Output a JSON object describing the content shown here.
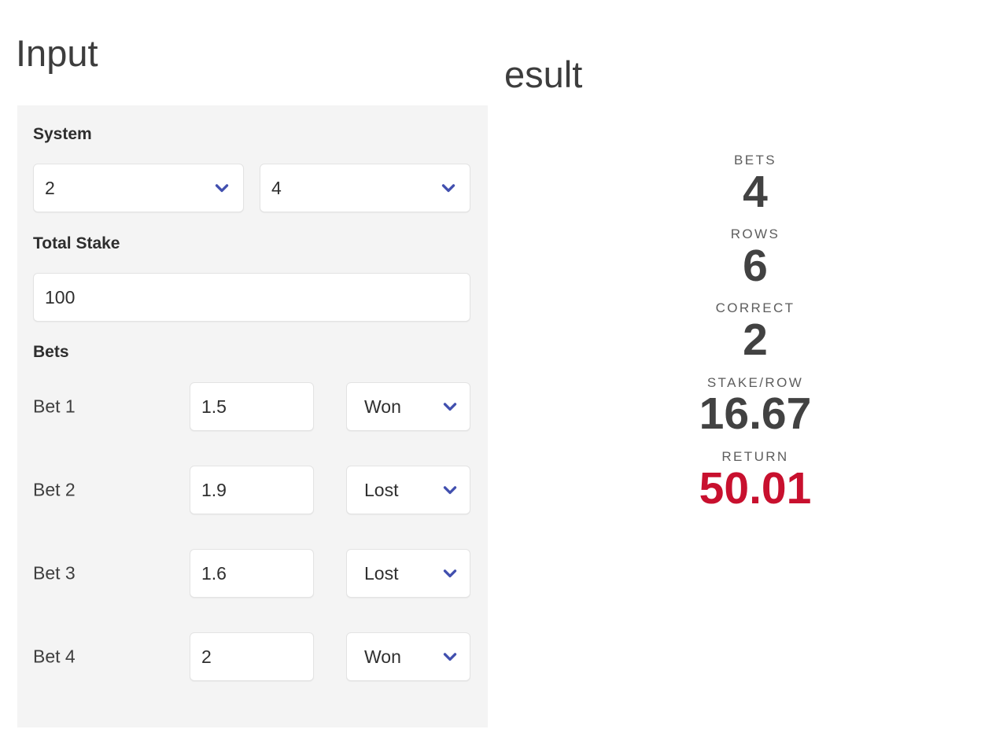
{
  "headings": {
    "input": "Input",
    "result": "esult"
  },
  "input_panel": {
    "system": {
      "label": "System",
      "select_left": {
        "value": "2",
        "icon": "chevron-down-icon"
      },
      "select_right": {
        "value": "4",
        "icon": "chevron-down-icon"
      }
    },
    "total_stake": {
      "label": "Total Stake",
      "value": "100"
    },
    "bets": {
      "label": "Bets",
      "rows": [
        {
          "label": "Bet 1",
          "odds": "1.5",
          "status": "Won"
        },
        {
          "label": "Bet 2",
          "odds": "1.9",
          "status": "Lost"
        },
        {
          "label": "Bet 3",
          "odds": "1.6",
          "status": "Lost"
        },
        {
          "label": "Bet 4",
          "odds": "2",
          "status": "Won"
        }
      ]
    }
  },
  "results": {
    "stats": [
      {
        "label": "BETS",
        "value": "4"
      },
      {
        "label": "ROWS",
        "value": "6"
      },
      {
        "label": "CORRECT",
        "value": "2"
      },
      {
        "label": "STAKE/ROW",
        "value": "16.67"
      },
      {
        "label": "RETURN",
        "value": "50.01"
      }
    ]
  },
  "colors": {
    "panel_background": "#f4f4f4",
    "page_background": "#ffffff",
    "heading_text": "#3d3d3d",
    "label_text": "#2e2e2e",
    "value_text": "#2f2f2f",
    "stat_label_text": "#5d5d5d",
    "stat_value_text": "#424242",
    "return_accent": "#c8102e",
    "chevron": "#4250af",
    "field_border": "#e3e3e3"
  }
}
